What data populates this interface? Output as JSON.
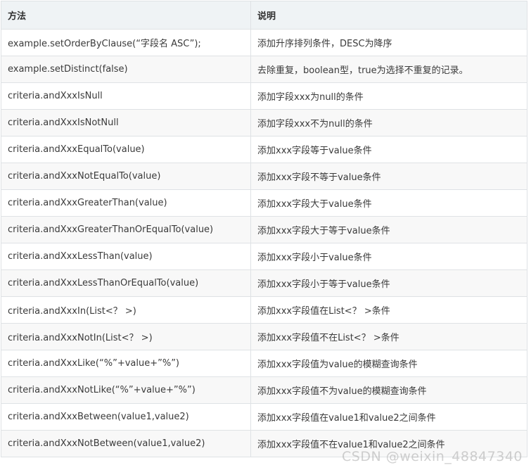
{
  "table": {
    "headers": [
      "方法",
      "说明"
    ],
    "rows": [
      {
        "method": "example.setOrderByClause(“字段名 ASC”);",
        "desc": "添加升序排列条件，DESC为降序"
      },
      {
        "method": "example.setDistinct(false)",
        "desc": "去除重复，boolean型，true为选择不重复的记录。"
      },
      {
        "method": "criteria.andXxxIsNull",
        "desc": "添加字段xxx为null的条件"
      },
      {
        "method": "criteria.andXxxIsNotNull",
        "desc": "添加字段xxx不为null的条件"
      },
      {
        "method": "criteria.andXxxEqualTo(value)",
        "desc": "添加xxx字段等于value条件"
      },
      {
        "method": "criteria.andXxxNotEqualTo(value)",
        "desc": "添加xxx字段不等于value条件"
      },
      {
        "method": "criteria.andXxxGreaterThan(value)",
        "desc": "添加xxx字段大于value条件"
      },
      {
        "method": "criteria.andXxxGreaterThanOrEqualTo(value)",
        "desc": "添加xxx字段大于等于value条件"
      },
      {
        "method": "criteria.andXxxLessThan(value)",
        "desc": "添加xxx字段小于value条件"
      },
      {
        "method": "criteria.andXxxLessThanOrEqualTo(value)",
        "desc": "添加xxx字段小于等于value条件"
      },
      {
        "method": "criteria.andXxxIn(List<？ >)",
        "desc": "添加xxx字段值在List<？ >条件"
      },
      {
        "method": "criteria.andXxxNotIn(List<？ >)",
        "desc": "添加xxx字段值不在List<？ >条件"
      },
      {
        "method": "criteria.andXxxLike(“%”+value+”%”)",
        "desc": "添加xxx字段值为value的模糊查询条件"
      },
      {
        "method": "criteria.andXxxNotLike(“%”+value+”%”)",
        "desc": "添加xxx字段值不为value的模糊查询条件"
      },
      {
        "method": "criteria.andXxxBetween(value1,value2)",
        "desc": "添加xxx字段值在value1和value2之间条件"
      },
      {
        "method": "criteria.andXxxNotBetween(value1,value2)",
        "desc": "添加xxx字段值不在value1和value2之间条件"
      }
    ]
  },
  "watermark": "CSDN @weixin_48847340"
}
